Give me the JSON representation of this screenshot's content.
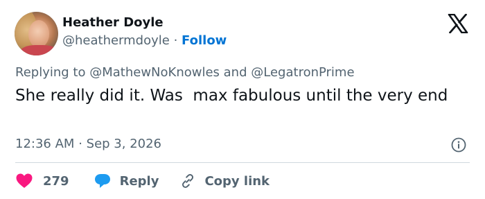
{
  "author": {
    "name": "Heather Doyle",
    "handle": "@heathermdoyle",
    "separator": "·",
    "follow_label": "Follow"
  },
  "reply_context": {
    "prefix": "Replying to",
    "user1": "@MathewNoKnowles",
    "conjunction": "and",
    "user2": "@LegatronPrime"
  },
  "tweet": {
    "text": "She really did it. Was  max fabulous until the very end"
  },
  "meta": {
    "time": "12:36 AM",
    "separator": "·",
    "date": "Sep 3, 2026"
  },
  "actions": {
    "like_count": "279",
    "reply_label": "Reply",
    "copy_label": "Copy link"
  },
  "icons": {
    "like": "heart-icon",
    "reply": "speech-bubble-icon",
    "copy": "link-icon",
    "info": "info-icon",
    "brand": "x-logo-icon"
  },
  "colors": {
    "link": "#0074d4",
    "like": "#f91880",
    "reply": "#1d9bf0",
    "secondary_text": "#536471",
    "primary_text": "#0f1419"
  }
}
